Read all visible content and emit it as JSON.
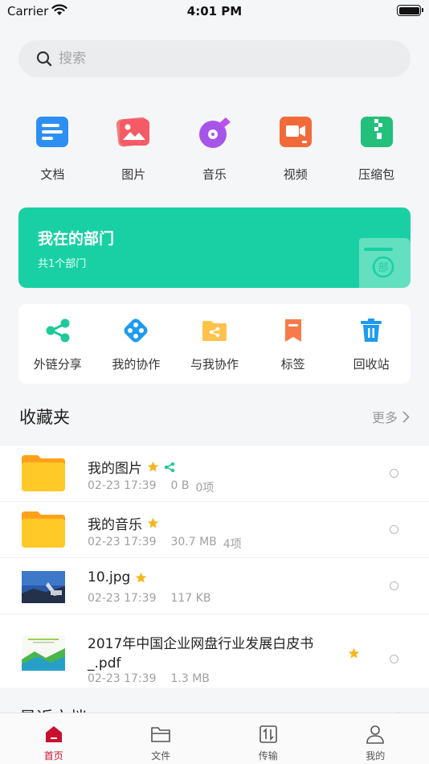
{
  "status_bar": {
    "carrier": "Carrier",
    "time": "4:01 PM"
  },
  "search": {
    "placeholder": "搜索"
  },
  "categories": [
    {
      "label": "文档",
      "icon": "document-icon"
    },
    {
      "label": "图片",
      "icon": "image-icon"
    },
    {
      "label": "音乐",
      "icon": "music-icon"
    },
    {
      "label": "视频",
      "icon": "video-icon"
    },
    {
      "label": "压缩包",
      "icon": "archive-icon"
    }
  ],
  "department": {
    "title": "我在的部门",
    "subtitle": "共1个部门",
    "badge": "部"
  },
  "tools": [
    {
      "label": "外链分享",
      "icon": "share-link-icon"
    },
    {
      "label": "我的协作",
      "icon": "my-collab-icon"
    },
    {
      "label": "与我协作",
      "icon": "shared-with-me-icon"
    },
    {
      "label": "标签",
      "icon": "tag-icon"
    },
    {
      "label": "回收站",
      "icon": "trash-icon"
    }
  ],
  "favorites": {
    "title": "收藏夹",
    "more": "更多",
    "items": [
      {
        "name": "我的图片",
        "date": "02-23 17:39",
        "size": "0 B",
        "count": "0项",
        "starred": true,
        "shared": true,
        "type": "folder"
      },
      {
        "name": "我的音乐",
        "date": "02-23 17:39",
        "size": "30.7 MB",
        "count": "4项",
        "starred": true,
        "shared": false,
        "type": "folder"
      },
      {
        "name": "10.jpg",
        "date": "02-23 17:39",
        "size": "117 KB",
        "count": "",
        "starred": true,
        "shared": false,
        "type": "photo"
      },
      {
        "name": "2017年中国企业网盘行业发展白皮书_.pdf",
        "date": "02-23 17:39",
        "size": "1.3 MB",
        "count": "",
        "starred": true,
        "shared": false,
        "type": "pdf"
      }
    ]
  },
  "recent": {
    "title": "最近文档",
    "more": "更多"
  },
  "tabbar": [
    {
      "label": "首页",
      "icon": "home-icon",
      "active": true
    },
    {
      "label": "文件",
      "icon": "folder-icon",
      "active": false
    },
    {
      "label": "传输",
      "icon": "transfer-icon",
      "active": false
    },
    {
      "label": "我的",
      "icon": "profile-icon",
      "active": false
    }
  ],
  "colors": {
    "accent": "#c8102e",
    "department_card": "#19d0a4",
    "star": "#f6b51e",
    "share": "#1fc99a",
    "folder": "#ffc928"
  }
}
